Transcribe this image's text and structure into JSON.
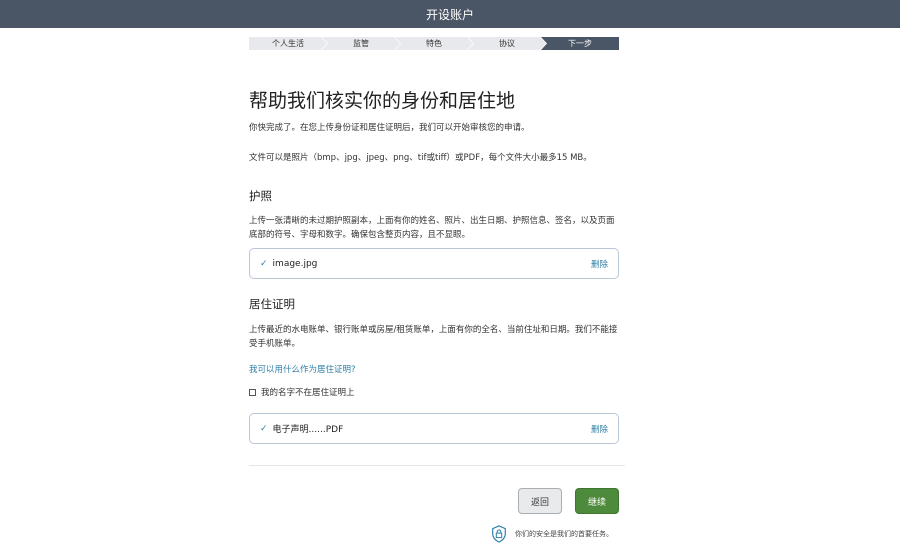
{
  "header": {
    "title": "开设账户"
  },
  "stepper": {
    "steps": [
      "个人生活",
      "监管",
      "特色",
      "协议",
      "下一步"
    ]
  },
  "main": {
    "heading": "帮助我们核实你的身份和居住地",
    "intro": "你快完成了。在您上传身份证和居住证明后，我们可以开始审核您的申请。",
    "file_note": "文件可以是照片（bmp、jpg、jpeg、png、tif或tiff）或PDF，每个文件大小最多15 MB。",
    "passport": {
      "title": "护照",
      "description": "上传一张清晰的未过期护照副本，上面有你的姓名、照片、出生日期、护照信息、签名，以及页面底部的符号、字母和数字。确保包含整页内容，且不显眼。",
      "file_name": "image.jpg",
      "delete_label": "删除"
    },
    "residence": {
      "title": "居住证明",
      "description": "上传最近的水电账单、银行账单或房屋/租赁账单，上面有你的全名、当前住址和日期。我们不能接受手机账单。",
      "help_link": "我可以用什么作为居住证明?",
      "checkbox_label": "我的名字不在居住证明上",
      "file_name": "电子声明......PDF",
      "delete_label": "删除"
    }
  },
  "footer": {
    "back_label": "返回",
    "continue_label": "继续",
    "security_text": "你们的安全是我们的首要任务。"
  },
  "colors": {
    "header_bg": "#4a5566",
    "link": "#2e7fa8",
    "continue_bg": "#4e8a3b"
  }
}
